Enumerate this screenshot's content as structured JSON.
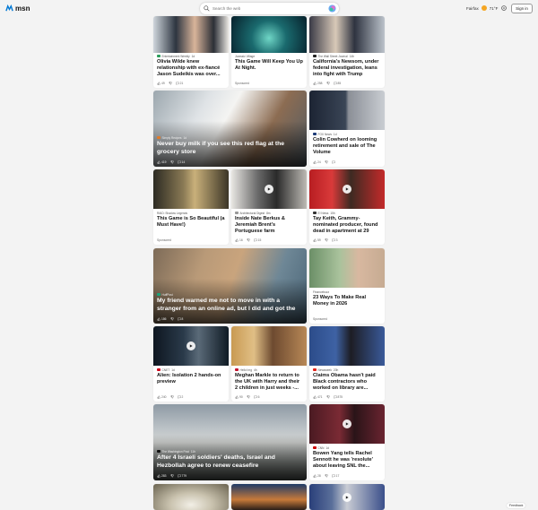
{
  "header": {
    "logo_text": "msn",
    "search_placeholder": "Search the web",
    "weather_location": "Fairfax",
    "weather_temp": "71°F",
    "sign_in_label": "Sign in"
  },
  "feedback_label": "Feedback",
  "cards": {
    "c1": {
      "source": "Entertainment Weekly",
      "age": "1d",
      "title": "Olivia Wilde knew relationship with ex-fiancé Jason Sudeikis was over...",
      "likes": "49",
      "comments": "21"
    },
    "c2": {
      "source": "Jurassic Village",
      "title": "This Game Will Keep You Up At Night.",
      "sponsored": "Sponsored"
    },
    "c3": {
      "source": "The Wall Street Journal",
      "age": "14h",
      "title": "California's Newsom, under federal investigation, leans into fight with Trump",
      "likes": "258",
      "comments": "85"
    },
    "c4": {
      "source": "Simply Recipes",
      "age": "1d",
      "title": "Never buy milk if you see this red flag at the grocery store",
      "likes": "419",
      "comments": "14"
    },
    "c5": {
      "source": "FOX News",
      "age": "1d",
      "title": "Colin Cowherd on looming retirement and sale of The Volume",
      "likes": "24",
      "comments": ""
    },
    "c6": {
      "source": "RAID: Shadow Legends",
      "title": "This Game is So Beautiful (a Must Have!)",
      "sponsored": "Sponsored"
    },
    "c7": {
      "source": "Architectural Digest",
      "age": "8m",
      "title": "Inside Nate Berkus & Jeremiah Brent's Portuguese farm",
      "likes": "16",
      "comments": "15"
    },
    "c8": {
      "source": "E! News",
      "age": "15h",
      "title": "Tay Keith, Grammy-nominated producer, found dead in apartment at 29",
      "likes": "59",
      "comments": "3"
    },
    "c9": {
      "source": "HuffPost",
      "title": "My friend warned me not to move in with a stranger from an online ad, but I did and got the surprise of...",
      "likes": "186",
      "comments": "8"
    },
    "c10": {
      "source": "Financebuzz",
      "title": "23 Ways To Make Real Money in 2026",
      "sponsored": "Sponsored"
    },
    "c11": {
      "source": "CNET",
      "age": "1d",
      "title": "Alien: Isolation 2 hands-on preview",
      "likes": "240",
      "comments": "2"
    },
    "c12": {
      "source": "Hello! mg",
      "age": "4h",
      "title": "Meghan Markle to return to the UK with Harry and their 2 children in just weeks -...",
      "likes": "90",
      "comments": "6"
    },
    "c13": {
      "source": "Newsweek",
      "age": "20h",
      "title": "Claims Obama hasn't paid Black contractors who worked on library are...",
      "likes": "471",
      "comments": "875"
    },
    "c14": {
      "source": "The Washington Post",
      "age": "11h",
      "title": "After 4 Israeli soldiers' deaths, Israel and Hezbollah agree to renew ceasefire",
      "likes": "283",
      "comments": "779"
    },
    "c15": {
      "source": "CNN",
      "age": "1d",
      "title": "Bowen Yang tells Rachel Sennott he was 'resolute' about leaving SNL the...",
      "likes": "28",
      "comments": "17"
    }
  },
  "colors": {
    "accent": "#0078d4",
    "sun": "#f5a623"
  }
}
